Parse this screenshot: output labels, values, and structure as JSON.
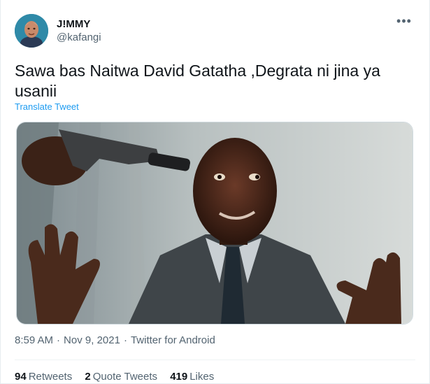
{
  "author": {
    "display_name": "J!MMY",
    "handle": "@kafangi",
    "avatar": "avatar-icon"
  },
  "more_icon": "more-dots-icon",
  "tweet": {
    "text": "Sawa bas Naitwa David Gatatha ,Degrata ni jina ya usanii",
    "translate_label": "Translate Tweet"
  },
  "media": {
    "alt": "photo of a frightened man in a suit with a gun pointed at his head"
  },
  "meta": {
    "time": "8:59 AM",
    "date": "Nov 9, 2021",
    "source": "Twitter for Android",
    "separator": "·"
  },
  "stats": {
    "retweets_count": "94",
    "retweets_label": "Retweets",
    "quotes_count": "2",
    "quotes_label": "Quote Tweets",
    "likes_count": "419",
    "likes_label": "Likes"
  },
  "colors": {
    "link": "#1d9bf0",
    "secondary_text": "#536471",
    "primary_text": "#0f1419"
  }
}
